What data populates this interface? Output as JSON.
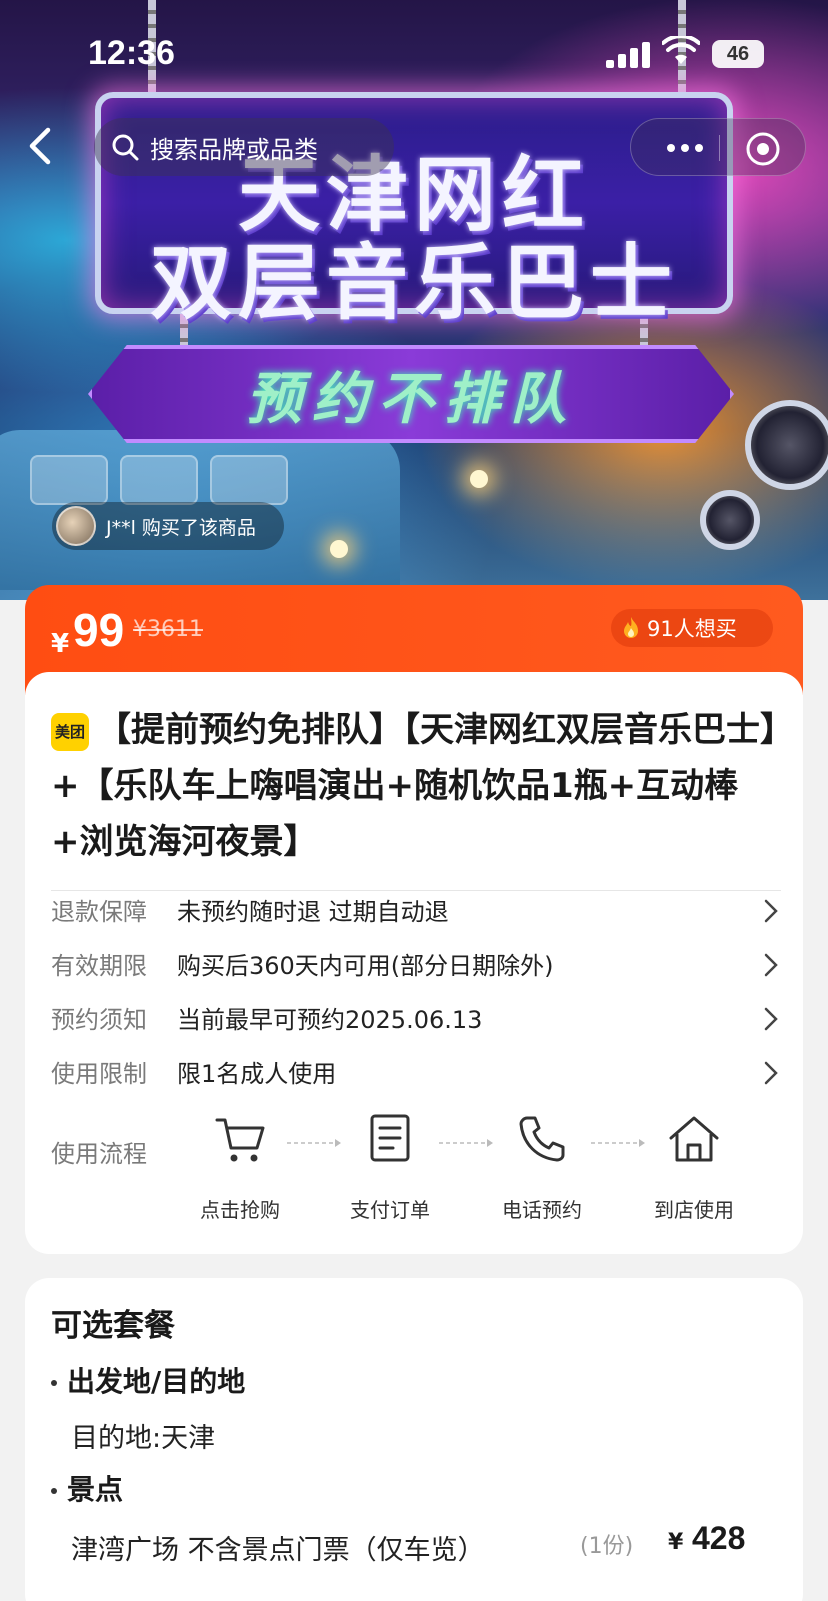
{
  "status_bar": {
    "time": "12:36",
    "battery": "46"
  },
  "nav": {
    "search_placeholder": "搜索品牌或品类"
  },
  "hero": {
    "title_line1": "天津网红",
    "title_line2": "双层音乐巴士",
    "subtitle": "预约不排队",
    "buyer_text": "J**l 购买了该商品"
  },
  "price": {
    "symbol": "¥",
    "current": "99",
    "original": "¥3611",
    "want_text": "91人想买"
  },
  "product": {
    "badge": "美团",
    "title": "【提前预约免排队】【天津网红双层音乐巴士】+【乐队车上嗨唱演出+随机饮品1瓶+互动棒+浏览海河夜景】"
  },
  "info_rows": [
    {
      "label": "退款保障",
      "value": "未预约随时退 过期自动退"
    },
    {
      "label": "有效期限",
      "value": "购买后360天内可用(部分日期除外)"
    },
    {
      "label": "预约须知",
      "value": "当前最早可预约2025.06.13"
    },
    {
      "label": "使用限制",
      "value": "限1名成人使用"
    }
  ],
  "flow": {
    "label": "使用流程",
    "steps": [
      {
        "icon": "cart-icon",
        "label": "点击抢购"
      },
      {
        "icon": "order-icon",
        "label": "支付订单"
      },
      {
        "icon": "phone-icon",
        "label": "电话预约"
      },
      {
        "icon": "home-icon",
        "label": "到店使用"
      }
    ]
  },
  "packages": {
    "title": "可选套餐",
    "section1": "出发地/目的地",
    "section1_item": "目的地:天津",
    "section2": "景点",
    "section2_item": "津湾广场 不含景点门票（仅车览）",
    "section2_qty": "(1份)",
    "section2_price_symbol": "¥",
    "section2_price": "428"
  },
  "colors": {
    "accent": "#ff5010",
    "badge_yellow": "#ffd100"
  }
}
